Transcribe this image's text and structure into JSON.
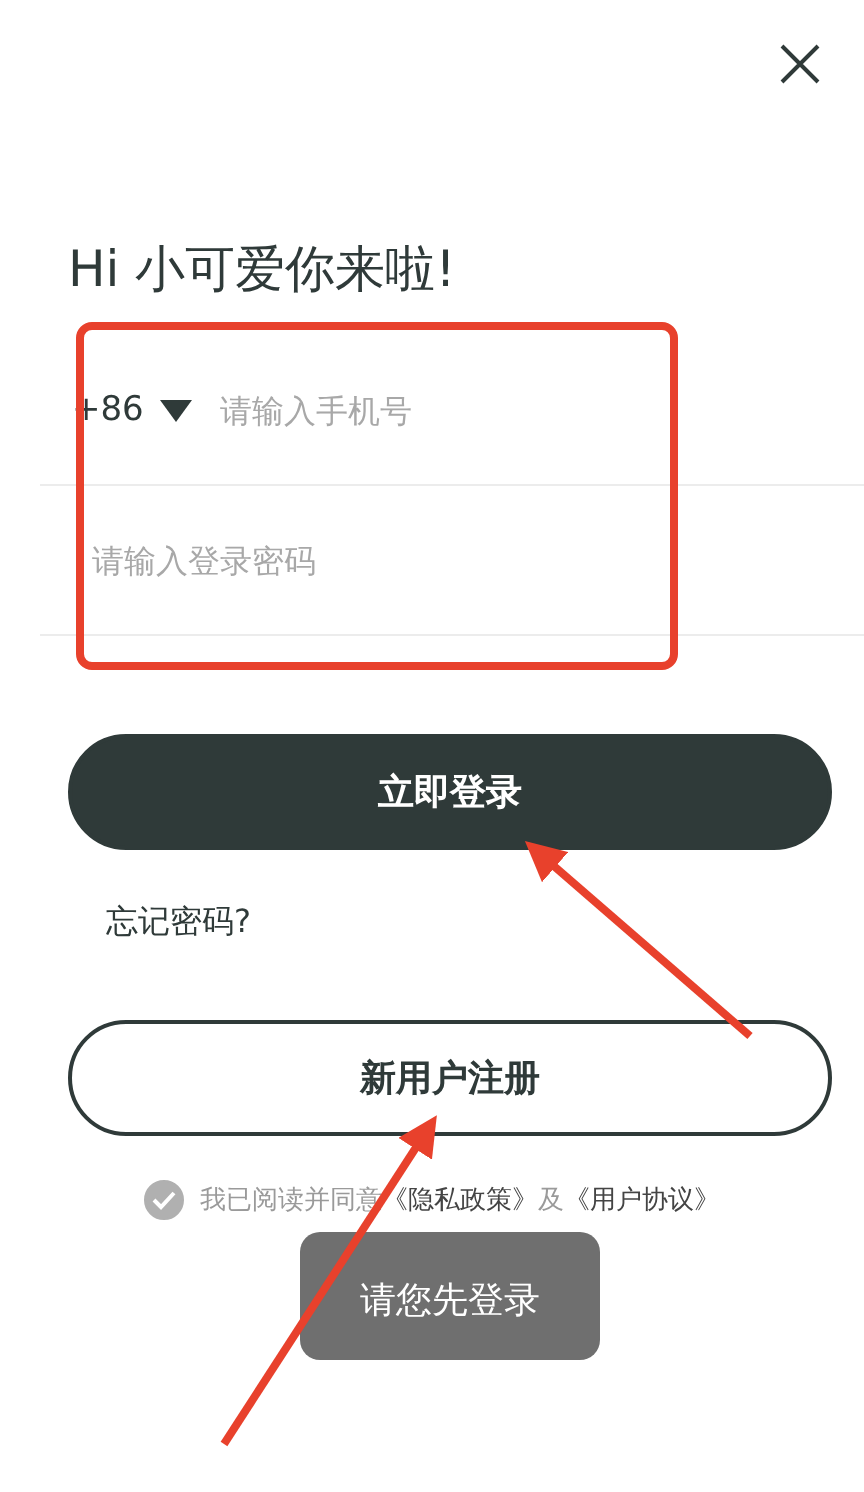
{
  "title": "Hi 小可爱你来啦!",
  "phone": {
    "country_code": "+86",
    "placeholder": "请输入手机号"
  },
  "password": {
    "placeholder": "请输入登录密码"
  },
  "login_button": "立即登录",
  "forgot_link": "忘记密码?",
  "register_button": "新用户注册",
  "agreement": {
    "checked": true,
    "text": "我已阅读并同意",
    "link_1": "《隐私政策》",
    "joiner": "及",
    "link_2": "《用户协议》"
  },
  "toast": "请您先登录"
}
